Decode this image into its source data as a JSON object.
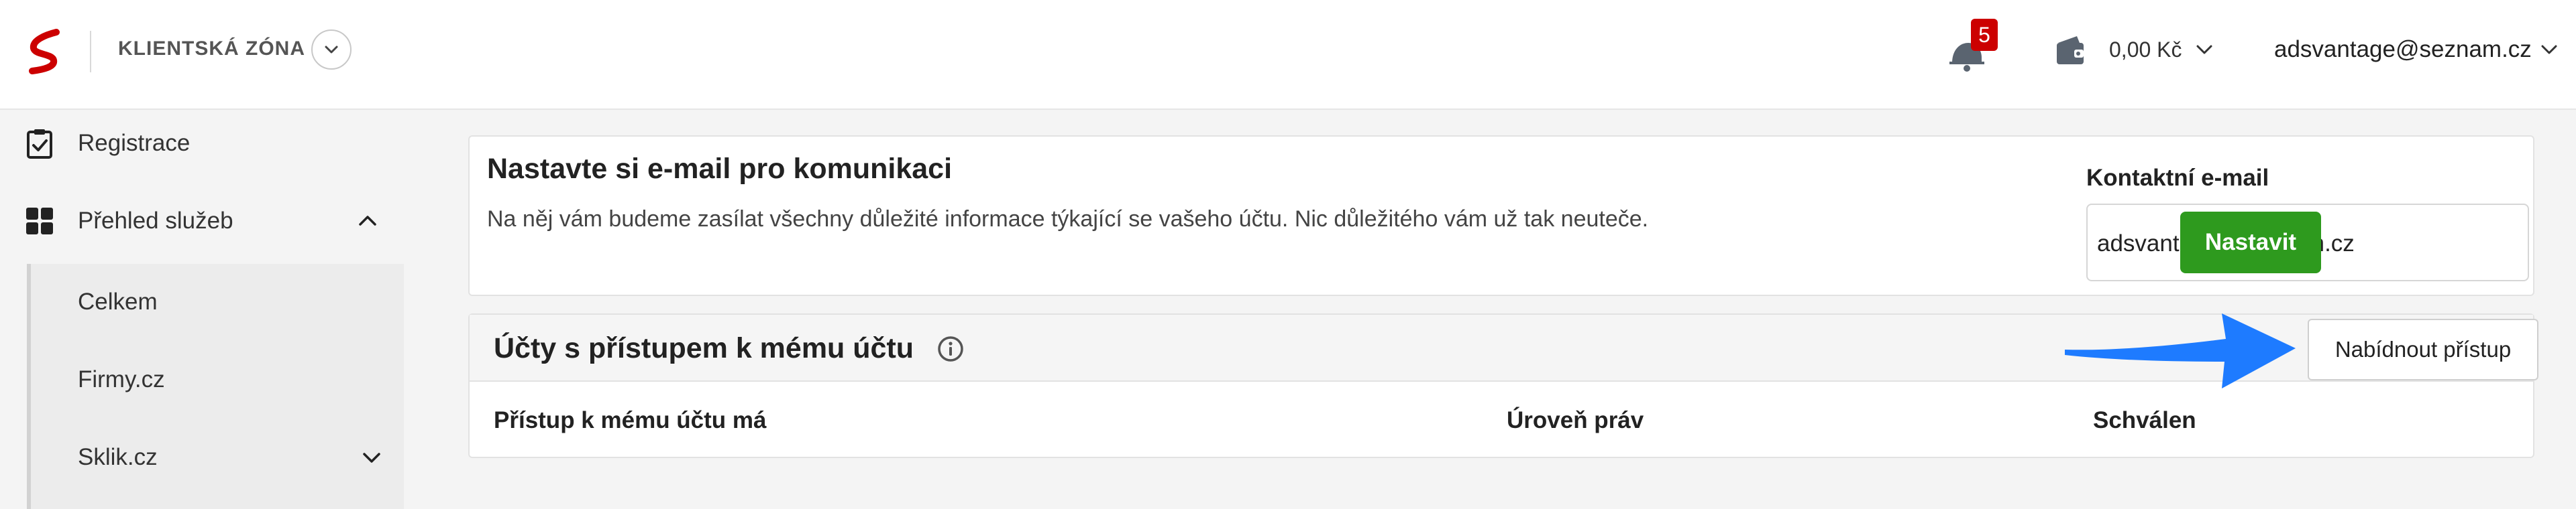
{
  "header": {
    "zone_title": "KLIENTSKÁ ZÓNA",
    "notification_count": "5",
    "balance": "0,00 Kč",
    "user_email": "adsvantage@seznam.cz"
  },
  "sidebar": {
    "items": [
      {
        "label": "Registrace",
        "icon": "clipboard-check-icon"
      },
      {
        "label": "Přehled služeb",
        "icon": "grid-icon"
      }
    ],
    "submenu": [
      {
        "label": "Celkem"
      },
      {
        "label": "Firmy.cz"
      },
      {
        "label": "Sklik.cz"
      }
    ]
  },
  "email_card": {
    "title": "Nastavte si e-mail pro komunikaci",
    "description": "Na něj vám budeme zasílat všechny důležité informace týkající se vašeho účtu. Nic důležitého vám už tak neuteče.",
    "contact_label": "Kontaktní e-mail",
    "contact_value": "adsvantage@seznam.cz",
    "set_button": "Nastavit"
  },
  "access_card": {
    "title": "Účty s přístupem k mému účtu",
    "offer_button": "Nabídnout přístup",
    "columns": [
      "Přístup k mému účtu má",
      "Úroveň práv",
      "Schválen"
    ]
  },
  "colors": {
    "brand_red": "#cc0000",
    "button_green": "#2e9a1e",
    "annotation_arrow": "#1e7bff"
  }
}
